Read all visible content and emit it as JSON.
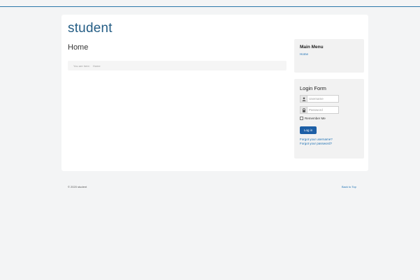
{
  "site": {
    "brand": "student"
  },
  "main": {
    "page_title": "Home",
    "breadcrumb": {
      "prefix": "You are here:",
      "current": "Home"
    }
  },
  "main_menu": {
    "title": "Main Menu",
    "items": [
      {
        "label": "Home"
      }
    ]
  },
  "login_form": {
    "title": "Login Form",
    "username_placeholder": "Username",
    "password_placeholder": "Password",
    "remember_label": "Remember Me",
    "submit_label": "Log in",
    "forgot_username": "Forgot your username?",
    "forgot_password": "Forgot your password?"
  },
  "footer": {
    "copyright": "© 2020 student",
    "back_to_top": "Back to Top"
  },
  "colors": {
    "background": "#f3f4f5",
    "card": "#ffffff",
    "brand_text": "#245d85",
    "link": "#1a6fb3",
    "button": "#1d5fa6",
    "module_bg": "#f2f2f2",
    "top_rule": "#2a78a8"
  }
}
